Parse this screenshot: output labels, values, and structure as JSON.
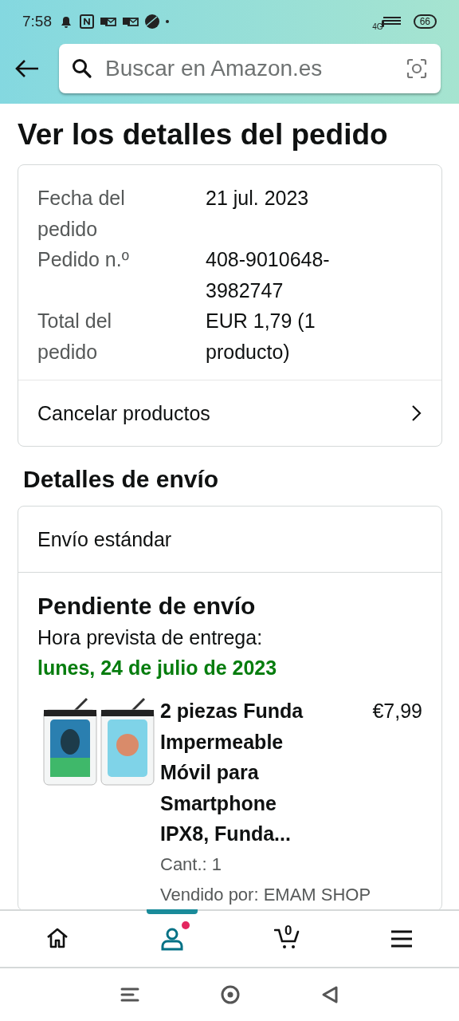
{
  "status_bar": {
    "time": "7:58",
    "network": "4G",
    "battery": "66"
  },
  "header": {
    "search": {
      "placeholder": "Buscar en Amazon.es"
    }
  },
  "title": "Ver los detalles del pedido",
  "order_summary": {
    "rows": [
      {
        "label": "Fecha del pedido",
        "value": "21 jul. 2023"
      },
      {
        "label": "Pedido n.º",
        "value": "408-9010648-3982747"
      },
      {
        "label": "Total del pedido",
        "value": "EUR 1,79 (1 producto)"
      }
    ],
    "action": "Cancelar productos"
  },
  "shipping": {
    "heading": "Detalles de envío",
    "method": "Envío estándar",
    "status": "Pendiente de envío",
    "delivery_label": "Hora prevista de entrega:",
    "delivery_date": "lunes, 24 de julio de 2023",
    "item": {
      "name": "2 piezas Funda Impermeable Móvil para Smartphone IPX8, Funda...",
      "price": "€7,99",
      "quantity": "Cant.: 1",
      "seller": "Vendido por: EMAM SHOP"
    }
  },
  "bottom_nav": [
    {
      "kind": "home",
      "selected": false
    },
    {
      "kind": "account",
      "selected": true,
      "notification": true
    },
    {
      "kind": "cart",
      "selected": false,
      "count": "0"
    },
    {
      "kind": "menu",
      "selected": false
    }
  ]
}
